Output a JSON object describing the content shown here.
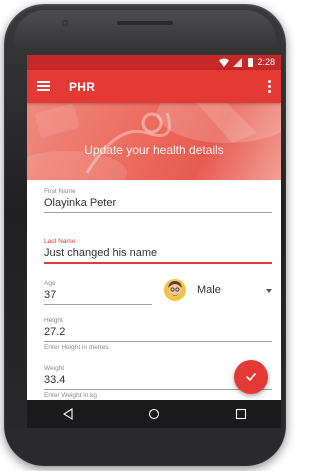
{
  "status_bar": {
    "time": "2:28",
    "icons": [
      "wifi-icon",
      "signal-icon",
      "battery-icon"
    ]
  },
  "app_bar": {
    "title": "PHR",
    "menu_icon": "menu-icon",
    "overflow_icon": "overflow-icon"
  },
  "hero": {
    "title": "Update your health details"
  },
  "form": {
    "first_name": {
      "label": "First Name",
      "value": "Olayinka Peter"
    },
    "last_name": {
      "label": "Last Name",
      "value": "Just changed his name"
    },
    "age": {
      "label": "Age",
      "value": "37"
    },
    "gender": {
      "value": "Male",
      "icon": "avatar-icon"
    },
    "height": {
      "label": "Height",
      "value": "27.2",
      "helper": "Enter Height in metres"
    },
    "weight": {
      "label": "Weight",
      "value": "33.4",
      "helper": "Enter Weight in kg"
    }
  },
  "fab": {
    "icon": "check-icon"
  },
  "navigation": {
    "icons": [
      "back-icon",
      "home-icon",
      "recent-apps-icon"
    ]
  },
  "colors": {
    "primary": "#e53935",
    "primary_dark": "#c62828",
    "accent": "#e53935",
    "nav_bar": "#1a1a1a",
    "phone_frame": "#2b2b2d"
  }
}
